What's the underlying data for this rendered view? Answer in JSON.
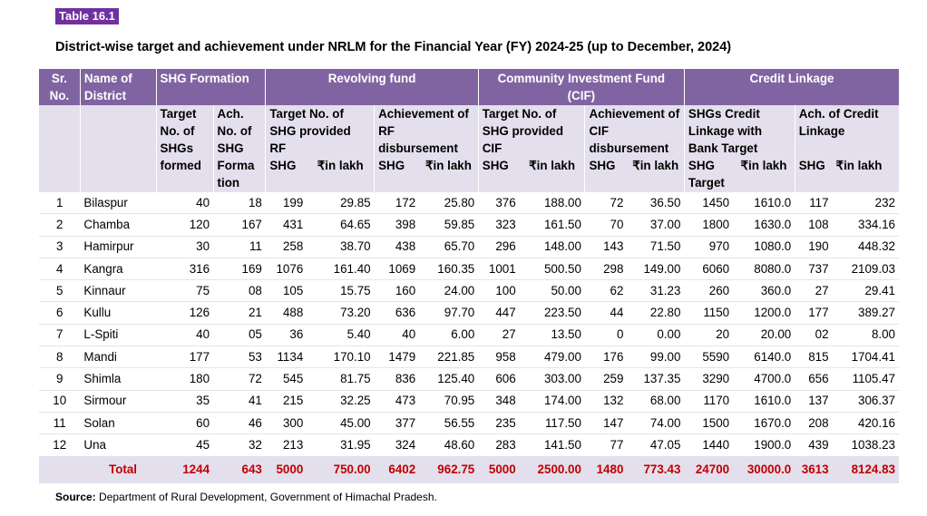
{
  "table_tag": "Table 16.1",
  "title": "District-wise target and achievement under NRLM for the Financial Year (FY) 2024-25 (up to December, 2024)",
  "headers": {
    "sr": "Sr. No.",
    "district": "Name of District",
    "shg_formation": "SHG Formation",
    "revolving_fund": "Revolving fund",
    "cif": "Community Investment Fund (CIF)",
    "credit_linkage": "Credit Linkage",
    "target_shgs_formed": "Target No. of SHGs formed",
    "ach_shg_formation": "Ach. No. of SHG Forma tion",
    "rf_target": "Target No. of SHG provided RF",
    "rf_ach": "Achievement of RF disbursement",
    "cif_target": "Target No. of SHG provided CIF",
    "cif_ach": "Achievement of CIF disbursement",
    "cl_target": "SHGs Credit Linkage with Bank Target",
    "cl_ach": "Ach. of Credit Linkage",
    "shg": "SHG",
    "in_lakh": "₹in lakh",
    "in_lakh_inline": "₹in lakh",
    "shg_target": "SHG Target",
    "lakh": "lakh"
  },
  "rows": [
    {
      "sr": "1",
      "district": "Bilaspur",
      "t": "40",
      "a": "18",
      "rf_shg": "199",
      "rf_l": "29.85",
      "rfa_shg": "172",
      "rfa_l": "25.80",
      "cif_shg": "376",
      "cif_l": "188.00",
      "cifa_shg": "72",
      "cifa_l": "36.50",
      "cl_shg": "1450",
      "cl_l": "1610.0",
      "cla_shg": "117",
      "cla_l": "232"
    },
    {
      "sr": "2",
      "district": "Chamba",
      "t": "120",
      "a": "167",
      "rf_shg": "431",
      "rf_l": "64.65",
      "rfa_shg": "398",
      "rfa_l": "59.85",
      "cif_shg": "323",
      "cif_l": "161.50",
      "cifa_shg": "70",
      "cifa_l": "37.00",
      "cl_shg": "1800",
      "cl_l": "1630.0",
      "cla_shg": "108",
      "cla_l": "334.16"
    },
    {
      "sr": "3",
      "district": "Hamirpur",
      "t": "30",
      "a": "11",
      "rf_shg": "258",
      "rf_l": "38.70",
      "rfa_shg": "438",
      "rfa_l": "65.70",
      "cif_shg": "296",
      "cif_l": "148.00",
      "cifa_shg": "143",
      "cifa_l": "71.50",
      "cl_shg": "970",
      "cl_l": "1080.0",
      "cla_shg": "190",
      "cla_l": "448.32"
    },
    {
      "sr": "4",
      "district": "Kangra",
      "t": "316",
      "a": "169",
      "rf_shg": "1076",
      "rf_l": "161.40",
      "rfa_shg": "1069",
      "rfa_l": "160.35",
      "cif_shg": "1001",
      "cif_l": "500.50",
      "cifa_shg": "298",
      "cifa_l": "149.00",
      "cl_shg": "6060",
      "cl_l": "8080.0",
      "cla_shg": "737",
      "cla_l": "2109.03"
    },
    {
      "sr": "5",
      "district": "Kinnaur",
      "t": "75",
      "a": "08",
      "rf_shg": "105",
      "rf_l": "15.75",
      "rfa_shg": "160",
      "rfa_l": "24.00",
      "cif_shg": "100",
      "cif_l": "50.00",
      "cifa_shg": "62",
      "cifa_l": "31.23",
      "cl_shg": "260",
      "cl_l": "360.0",
      "cla_shg": "27",
      "cla_l": "29.41"
    },
    {
      "sr": "6",
      "district": "Kullu",
      "t": "126",
      "a": "21",
      "rf_shg": "488",
      "rf_l": "73.20",
      "rfa_shg": "636",
      "rfa_l": "97.70",
      "cif_shg": "447",
      "cif_l": "223.50",
      "cifa_shg": "44",
      "cifa_l": "22.80",
      "cl_shg": "1150",
      "cl_l": "1200.0",
      "cla_shg": "177",
      "cla_l": "389.27"
    },
    {
      "sr": "7",
      "district": "L-Spiti",
      "t": "40",
      "a": "05",
      "rf_shg": "36",
      "rf_l": "5.40",
      "rfa_shg": "40",
      "rfa_l": "6.00",
      "cif_shg": "27",
      "cif_l": "13.50",
      "cifa_shg": "0",
      "cifa_l": "0.00",
      "cl_shg": "20",
      "cl_l": "20.00",
      "cla_shg": "02",
      "cla_l": "8.00"
    },
    {
      "sr": "8",
      "district": "Mandi",
      "t": "177",
      "a": "53",
      "rf_shg": "1134",
      "rf_l": "170.10",
      "rfa_shg": "1479",
      "rfa_l": "221.85",
      "cif_shg": "958",
      "cif_l": "479.00",
      "cifa_shg": "176",
      "cifa_l": "99.00",
      "cl_shg": "5590",
      "cl_l": "6140.0",
      "cla_shg": "815",
      "cla_l": "1704.41"
    },
    {
      "sr": "9",
      "district": "Shimla",
      "t": "180",
      "a": "72",
      "rf_shg": "545",
      "rf_l": "81.75",
      "rfa_shg": "836",
      "rfa_l": "125.40",
      "cif_shg": "606",
      "cif_l": "303.00",
      "cifa_shg": "259",
      "cifa_l": "137.35",
      "cl_shg": "3290",
      "cl_l": "4700.0",
      "cla_shg": "656",
      "cla_l": "1105.47"
    },
    {
      "sr": "10",
      "district": "Sirmour",
      "t": "35",
      "a": "41",
      "rf_shg": "215",
      "rf_l": "32.25",
      "rfa_shg": "473",
      "rfa_l": "70.95",
      "cif_shg": "348",
      "cif_l": "174.00",
      "cifa_shg": "132",
      "cifa_l": "68.00",
      "cl_shg": "1170",
      "cl_l": "1610.0",
      "cla_shg": "137",
      "cla_l": "306.37"
    },
    {
      "sr": "11",
      "district": "Solan",
      "t": "60",
      "a": "46",
      "rf_shg": "300",
      "rf_l": "45.00",
      "rfa_shg": "377",
      "rfa_l": "56.55",
      "cif_shg": "235",
      "cif_l": "117.50",
      "cifa_shg": "147",
      "cifa_l": "74.00",
      "cl_shg": "1500",
      "cl_l": "1670.0",
      "cla_shg": "208",
      "cla_l": "420.16"
    },
    {
      "sr": "12",
      "district": "Una",
      "t": "45",
      "a": "32",
      "rf_shg": "213",
      "rf_l": "31.95",
      "rfa_shg": "324",
      "rfa_l": "48.60",
      "cif_shg": "283",
      "cif_l": "141.50",
      "cifa_shg": "77",
      "cifa_l": "47.05",
      "cl_shg": "1440",
      "cl_l": "1900.0",
      "cla_shg": "439",
      "cla_l": "1038.23"
    }
  ],
  "total": {
    "label": "Total",
    "t": "1244",
    "a": "643",
    "rf_shg": "5000",
    "rf_l": "750.00",
    "rfa_shg": "6402",
    "rfa_l": "962.75",
    "cif_shg": "5000",
    "cif_l": "2500.00",
    "cifa_shg": "1480",
    "cifa_l": "773.43",
    "cl_shg": "24700",
    "cl_l": "30000.0",
    "cla_shg": "3613",
    "cla_l": "8124.83"
  },
  "source_label": "Source:",
  "source_text": " Department of Rural Development, Government of Himachal Pradesh.",
  "colors": {
    "header_bg": "#8064a2",
    "subheader_bg": "#e4dfec",
    "tag_bg": "#7030a0",
    "total_text": "#c00000"
  }
}
